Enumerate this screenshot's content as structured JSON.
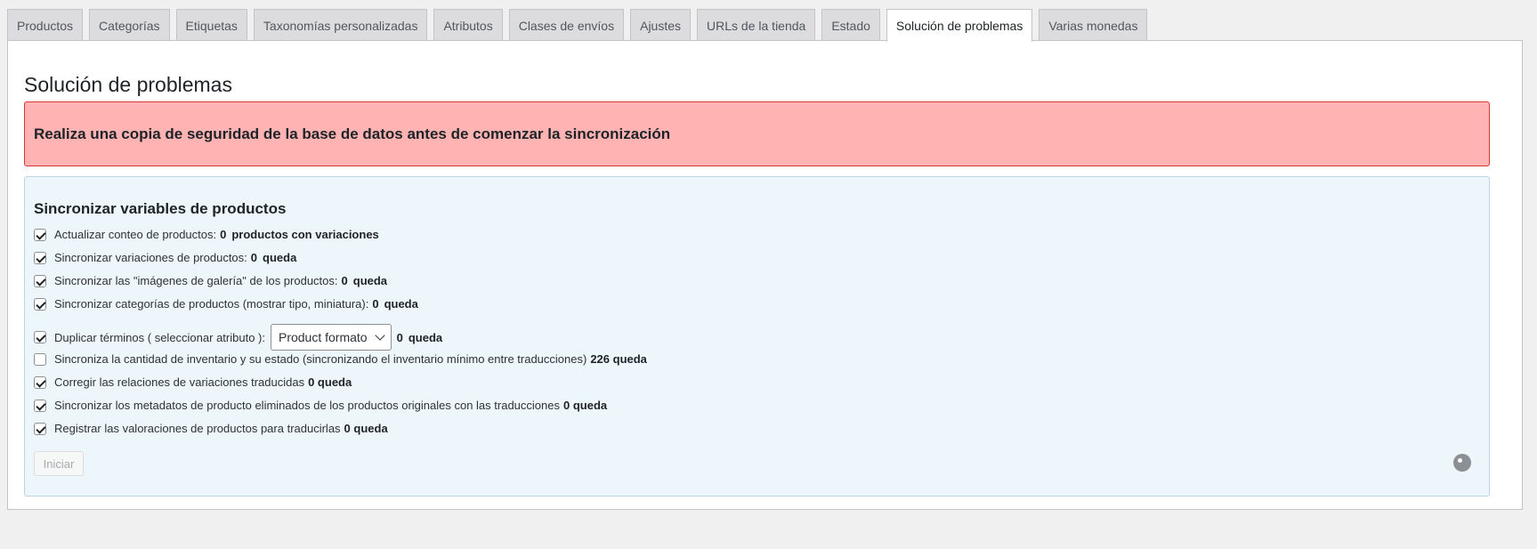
{
  "tabs": [
    {
      "label": "Productos",
      "active": false
    },
    {
      "label": "Categorías",
      "active": false
    },
    {
      "label": "Etiquetas",
      "active": false
    },
    {
      "label": "Taxonomías personalizadas",
      "active": false
    },
    {
      "label": "Atributos",
      "active": false
    },
    {
      "label": "Clases de envíos",
      "active": false
    },
    {
      "label": "Ajustes",
      "active": false
    },
    {
      "label": "URLs de la tienda",
      "active": false
    },
    {
      "label": "Estado",
      "active": false
    },
    {
      "label": "Solución de problemas",
      "active": true
    },
    {
      "label": "Varias monedas",
      "active": false
    }
  ],
  "page": {
    "title": "Solución de problemas",
    "warning": "Realiza una copia de seguridad de la base de datos antes de comenzar la sincronización"
  },
  "sync": {
    "title": "Sincronizar variables de productos",
    "items": [
      {
        "label": "Actualizar conteo de productos:",
        "count": "0",
        "suffix": "productos con variaciones",
        "checked": true
      },
      {
        "label": "Sincronizar variaciones de productos:",
        "count": "0",
        "suffix": "queda",
        "checked": true
      },
      {
        "label": "Sincronizar las \"imágenes de galería\" de los productos:",
        "count": "0",
        "suffix": "queda",
        "checked": true
      },
      {
        "label": "Sincronizar categorías de productos (mostrar tipo, miniatura):",
        "count": "0",
        "suffix": "queda",
        "checked": true
      },
      {
        "label": "Duplicar términos ( seleccionar atributo ):",
        "select_value": "Product formato",
        "count": "0",
        "suffix": "queda",
        "checked": true
      },
      {
        "label": "Sincroniza la cantidad de inventario y su estado (sincronizando el inventario mínimo entre traducciones)",
        "count": "226 queda",
        "checked": false
      },
      {
        "label": "Corregir las relaciones de variaciones traducidas",
        "count": "0 queda",
        "checked": true
      },
      {
        "label": "Sincronizar los metadatos de producto eliminados de los productos originales con las traducciones",
        "count": "0 queda",
        "checked": true
      },
      {
        "label": "Registrar las valoraciones de productos para traducirlas",
        "count": "0 queda",
        "checked": true
      }
    ],
    "start_button": "Iniciar"
  }
}
